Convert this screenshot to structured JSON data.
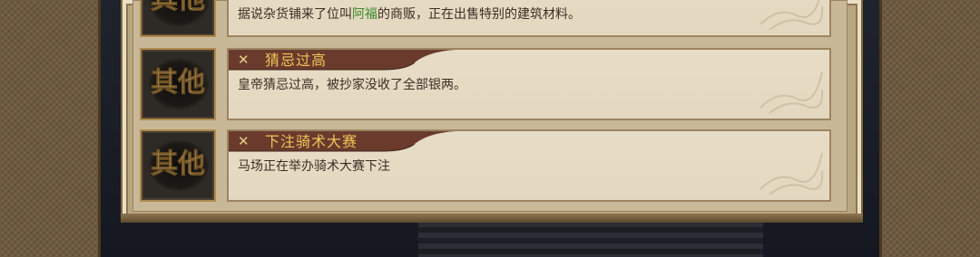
{
  "events": [
    {
      "category": "其他",
      "title": "",
      "description_before": "据说杂货铺来了位叫",
      "description_highlight": "阿福",
      "description_after": "的商贩，正在出售特别的建筑材料。"
    },
    {
      "category": "其他",
      "title": "猜忌过高",
      "description": "皇帝猜忌过高，被抄家没收了全部银两。"
    },
    {
      "category": "其他",
      "title": "下注骑术大赛",
      "description": "马场正在举办骑术大赛下注"
    }
  ],
  "colors": {
    "title": "#f0c45a",
    "highlight": "#3c8b2b",
    "description": "#3a2f24",
    "ribbon": "#6a3b2d"
  }
}
